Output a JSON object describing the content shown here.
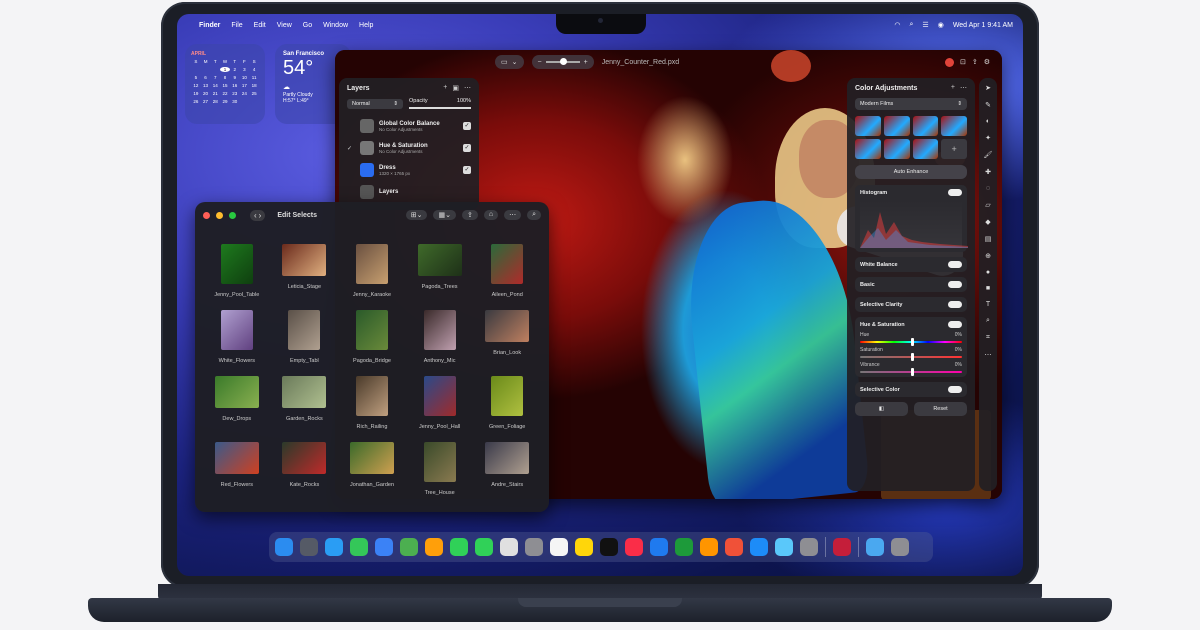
{
  "menubar": {
    "app_name": "Finder",
    "items": [
      "File",
      "Edit",
      "View",
      "Go",
      "Window",
      "Help"
    ],
    "clock": "Wed Apr 1  9:41 AM"
  },
  "calendar_widget": {
    "month": "APRIL",
    "weekdays": [
      "S",
      "M",
      "T",
      "W",
      "T",
      "F",
      "S"
    ],
    "days": [
      "",
      "",
      "",
      "1",
      "2",
      "3",
      "4",
      "5",
      "6",
      "7",
      "8",
      "9",
      "10",
      "11",
      "12",
      "13",
      "14",
      "15",
      "16",
      "17",
      "18",
      "19",
      "20",
      "21",
      "22",
      "23",
      "24",
      "25",
      "26",
      "27",
      "28",
      "29",
      "30",
      "",
      ""
    ],
    "today": "1"
  },
  "weather_widget": {
    "city": "San Francisco",
    "temp": "54°",
    "condition": "Partly Cloudy",
    "high_low": "H:57° L:49°"
  },
  "editor": {
    "document_title": "Jenny_Counter_Red.pxd",
    "layers_panel": {
      "title": "Layers",
      "blend_mode": "Normal",
      "opacity_label": "Opacity",
      "opacity_value": "100%",
      "layers": [
        {
          "name": "Global Color Balance",
          "sub": "No Color Adjustments",
          "checked": false
        },
        {
          "name": "Hue & Saturation",
          "sub": "No Color Adjustments",
          "checked": true
        },
        {
          "name": "Dress",
          "sub": "1320 × 1765 px",
          "checked": false
        },
        {
          "name": "Layers",
          "sub": "",
          "checked": false
        }
      ]
    },
    "color_panel": {
      "title": "Color Adjustments",
      "preset": "Modern Films",
      "auto_enhance": "Auto Enhance",
      "sections": [
        "Histogram",
        "White Balance",
        "Basic",
        "Selective Clarity",
        "Hue & Saturation",
        "Selective Color"
      ],
      "sliders": [
        {
          "label": "Hue",
          "value": "0%"
        },
        {
          "label": "Saturation",
          "value": "0%"
        },
        {
          "label": "Vibrance",
          "value": "0%"
        }
      ],
      "reset": "Reset"
    }
  },
  "edit_selects": {
    "title": "Edit Selects",
    "photos": [
      "Jenny_Pool_Table",
      "Leticia_Stage",
      "Jenny_Karaoke",
      "Pagoda_Trees",
      "Aileen_Pond",
      "White_Flowers",
      "Empty_Tabl",
      "Pagoda_Bridge",
      "Anthony_Mic",
      "Brian_Look",
      "Dew_Drops",
      "Garden_Rocks",
      "Rich_Railing",
      "Jenny_Pool_Hall",
      "Green_Foliage",
      "Red_Flowers",
      "Kate_Rocks",
      "Jonathan_Garden",
      "Tree_House",
      "Andre_Stairs"
    ]
  },
  "dock": {
    "apps": [
      "finder-icon",
      "launchpad-icon",
      "safari-icon",
      "messages-icon",
      "mail-icon",
      "maps-icon",
      "photos-icon",
      "facetime-icon",
      "phone-icon",
      "calendar-icon",
      "contacts-icon",
      "reminders-icon",
      "notes-icon",
      "tv-icon",
      "music-icon",
      "keynote-icon",
      "numbers-icon",
      "pages-icon",
      "swift-icon",
      "appstore-icon",
      "preview-icon",
      "settings-icon",
      "pixelmator-icon",
      "downloads-folder-icon",
      "trash-icon"
    ]
  },
  "colors": {
    "accent": "#2a6cf0",
    "menubar_text": "#ffffff"
  }
}
